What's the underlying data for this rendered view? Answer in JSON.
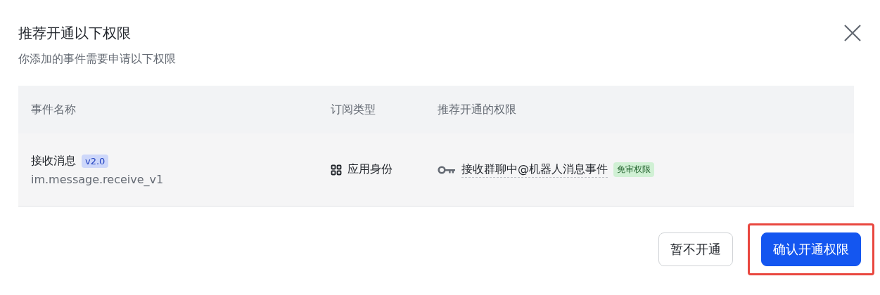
{
  "dialog": {
    "title": "推荐开通以下权限",
    "subtitle": "你添加的事件需要申请以下权限"
  },
  "table": {
    "columns": [
      "事件名称",
      "订阅类型",
      "推荐开通的权限"
    ],
    "rows": [
      {
        "event_name": "接收消息",
        "version": "v2.0",
        "event_key": "im.message.receive_v1",
        "subscription_type": "应用身份",
        "permission": "接收群聊中@机器人消息事件",
        "permission_tag": "免审权限"
      }
    ]
  },
  "buttons": [
    {
      "label": "暂不开通",
      "kind": "secondary",
      "highlighted": false
    },
    {
      "label": "确认开通权限",
      "kind": "primary",
      "highlighted": true
    }
  ]
}
